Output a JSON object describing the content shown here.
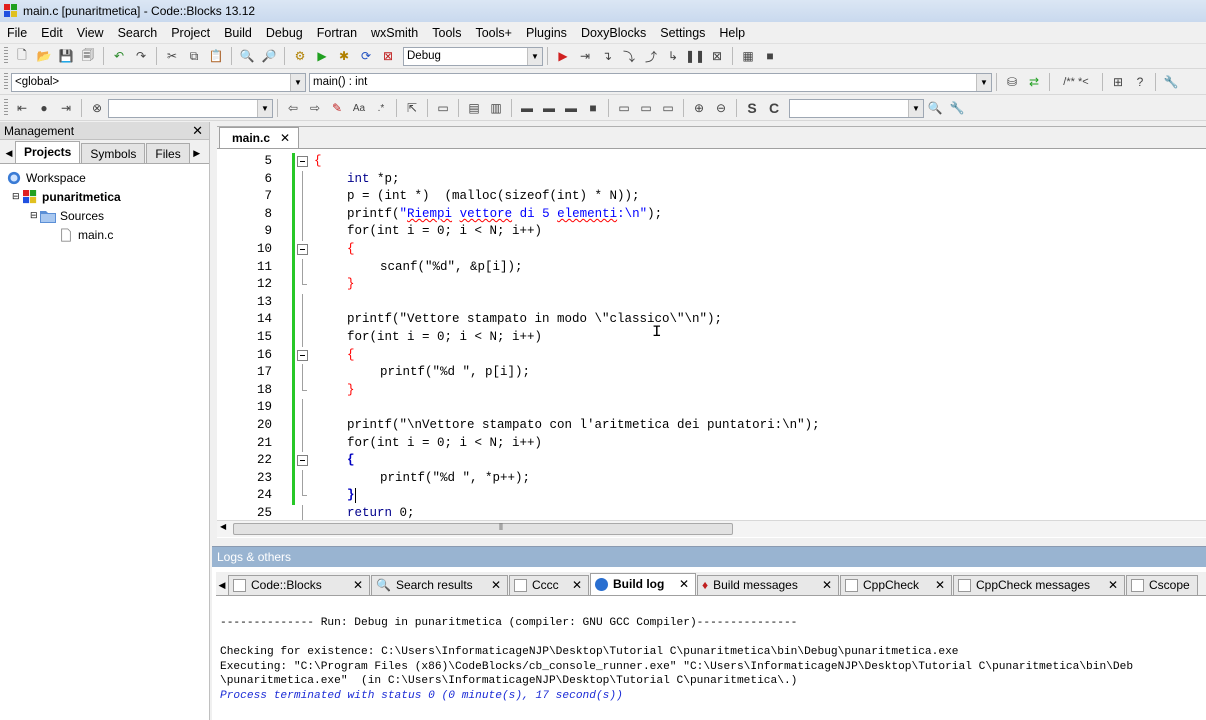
{
  "window": {
    "title": "main.c [punaritmetica] - Code::Blocks 13.12"
  },
  "menu": [
    "File",
    "Edit",
    "View",
    "Search",
    "Project",
    "Build",
    "Debug",
    "Fortran",
    "wxSmith",
    "Tools",
    "Tools+",
    "Plugins",
    "DoxyBlocks",
    "Settings",
    "Help"
  ],
  "toolbar": {
    "build_target": "Debug",
    "scope": "<global>",
    "function": "main() : int",
    "search_value": "",
    "search_value2": ""
  },
  "management": {
    "title": "Management",
    "tabs": [
      "Projects",
      "Symbols",
      "Files"
    ],
    "tree": {
      "workspace": "Workspace",
      "project": "punaritmetica",
      "folder": "Sources",
      "file": "main.c"
    }
  },
  "editor": {
    "tab": "main.c",
    "lines": [
      {
        "n": "5"
      },
      {
        "n": "6"
      },
      {
        "n": "7"
      },
      {
        "n": "8"
      },
      {
        "n": "9"
      },
      {
        "n": "10"
      },
      {
        "n": "11"
      },
      {
        "n": "12"
      },
      {
        "n": "13"
      },
      {
        "n": "14"
      },
      {
        "n": "15"
      },
      {
        "n": "16"
      },
      {
        "n": "17"
      },
      {
        "n": "18"
      },
      {
        "n": "19"
      },
      {
        "n": "20"
      },
      {
        "n": "21"
      },
      {
        "n": "22"
      },
      {
        "n": "23"
      },
      {
        "n": "24"
      },
      {
        "n": "25"
      }
    ],
    "code": {
      "l5": "{",
      "l6a": "int",
      "l6b": " *p;",
      "l7": "p = (int *)  (malloc(sizeof(int) * N));",
      "l8a": "printf(",
      "l8b": "\"",
      "l8c": "Riempi",
      "l8d": " ",
      "l8e": "vettore",
      "l8f": " di 5 ",
      "l8g": "elementi",
      "l8h": ":\\n\"",
      "l8i": ");",
      "l9": "for(int i = 0; i < N; i++)",
      "l10": "{",
      "l11": "scanf(\"%d\", &p[i]);",
      "l12": "}",
      "l14": "printf(\"Vettore stampato in modo \\\"classico\\\"\\n\");",
      "l15": "for(int i = 0; i < N; i++)",
      "l16": "{",
      "l17": "printf(\"%d \", p[i]);",
      "l18": "}",
      "l20": "printf(\"\\nVettore stampato con l'aritmetica dei puntatori:\\n\");",
      "l21": "for(int i = 0; i < N; i++)",
      "l22": "{",
      "l23": "printf(\"%d \", *p++);",
      "l24": "}",
      "l25a": "return",
      "l25b": " 0;"
    }
  },
  "logs": {
    "title": "Logs & others",
    "tabs": [
      "Code::Blocks",
      "Search results",
      "Cccc",
      "Build log",
      "Build messages",
      "CppCheck",
      "CppCheck messages",
      "Cscope"
    ],
    "active_tab": "Build log",
    "lines": [
      "-------------- Run: Debug in punaritmetica (compiler: GNU GCC Compiler)---------------",
      "",
      "Checking for existence: C:\\Users\\InformaticageNJP\\Desktop\\Tutorial C\\punaritmetica\\bin\\Debug\\punaritmetica.exe",
      "Executing: \"C:\\Program Files (x86)\\CodeBlocks/cb_console_runner.exe\" \"C:\\Users\\InformaticageNJP\\Desktop\\Tutorial C\\punaritmetica\\bin\\Deb",
      "\\punaritmetica.exe\"  (in C:\\Users\\InformaticageNJP\\Desktop\\Tutorial C\\punaritmetica\\.)"
    ],
    "status": "Process terminated with status 0 (0 minute(s), 17 second(s))"
  },
  "colors": {
    "keyword": "#00008b",
    "string": "#0000ff",
    "operator": "#ff0000",
    "number": "#ff00ff",
    "changebar": "#28c828",
    "logs_header": "#99b4d1"
  }
}
